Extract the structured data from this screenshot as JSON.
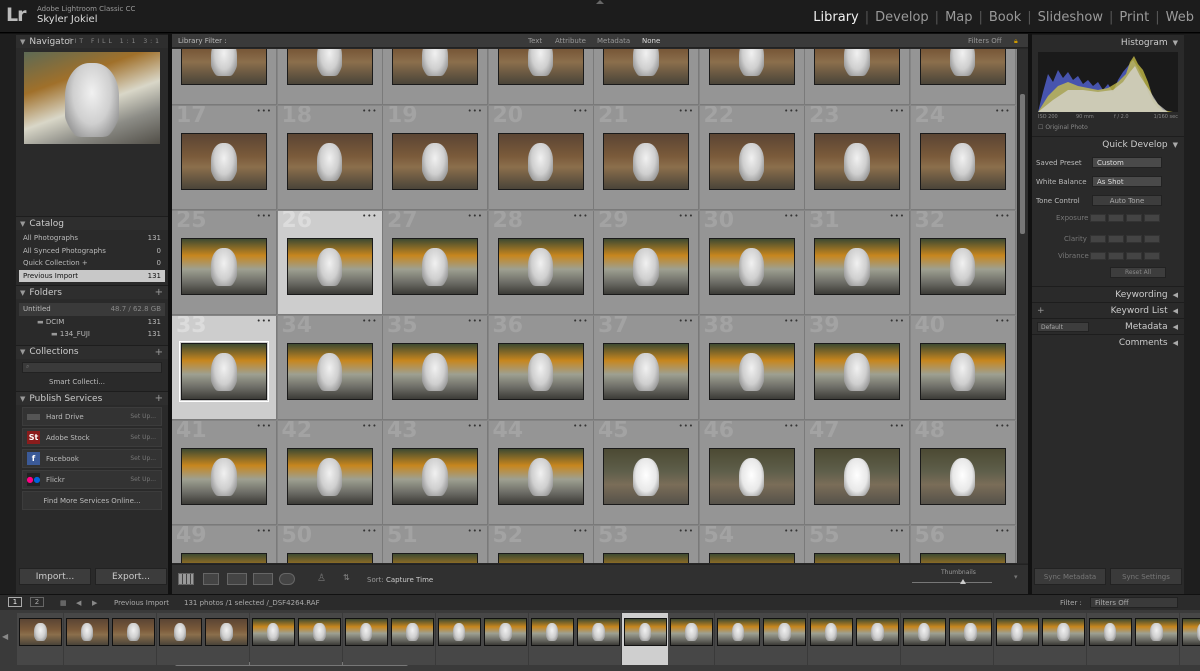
{
  "app": {
    "logo": "Lr",
    "name": "Adobe Lightroom Classic CC",
    "user": "Skyler Jokiel"
  },
  "modules": [
    "Library",
    "Develop",
    "Map",
    "Book",
    "Slideshow",
    "Print",
    "Web"
  ],
  "active_module": "Library",
  "navigator": {
    "title": "Navigator",
    "options": "FIT  FILL  1:1  3:1"
  },
  "catalog": {
    "title": "Catalog",
    "items": [
      {
        "label": "All Photographs",
        "count": "131"
      },
      {
        "label": "All Synced Photographs",
        "count": "0"
      },
      {
        "label": "Quick Collection +",
        "count": "0"
      },
      {
        "label": "Previous Import",
        "count": "131"
      }
    ]
  },
  "folders": {
    "title": "Folders",
    "volume": "Untitled",
    "volume_info": "48.7 / 62.8 GB",
    "items": [
      {
        "label": "DCIM",
        "count": "131"
      },
      {
        "label": "134_FUJI",
        "count": "131"
      }
    ]
  },
  "collections": {
    "title": "Collections",
    "search_placeholder": "",
    "items": [
      {
        "label": "Smart Collecti..."
      }
    ]
  },
  "publish": {
    "title": "Publish Services",
    "items": [
      {
        "label": "Hard Drive",
        "action": "Set Up..."
      },
      {
        "label": "Adobe Stock",
        "action": "Set Up..."
      },
      {
        "label": "Facebook",
        "action": "Set Up..."
      },
      {
        "label": "Flickr",
        "action": "Set Up..."
      }
    ],
    "find_more": "Find More Services Online..."
  },
  "left_buttons": {
    "import": "Import...",
    "export": "Export..."
  },
  "filter_bar": {
    "title": "Library Filter :",
    "text": "Text",
    "attribute": "Attribute",
    "metadata": "Metadata",
    "none": "None",
    "filters_off": "Filters Off"
  },
  "grid": {
    "row_numbers": [
      17,
      25,
      33,
      41,
      49
    ],
    "columns": 8,
    "selected_index": 33,
    "hover_index": 26
  },
  "toolbar": {
    "sort_label": "Sort:",
    "sort_value": "Capture Time",
    "thumbnails_label": "Thumbnails"
  },
  "right_panel": {
    "histogram": {
      "title": "Histogram",
      "iso": "ISO 200",
      "focal": "90 mm",
      "aperture": "f / 2.0",
      "shutter": "1/160 sec",
      "original": "Original Photo"
    },
    "quick_develop": {
      "title": "Quick Develop",
      "saved_preset_label": "Saved Preset",
      "saved_preset_value": "Custom",
      "white_balance_label": "White Balance",
      "white_balance_value": "As Shot",
      "tone_control_label": "Tone Control",
      "auto_tone": "Auto Tone",
      "exposure": "Exposure",
      "clarity": "Clarity",
      "vibrance": "Vibrance",
      "reset": "Reset All"
    },
    "keywording": "Keywording",
    "keyword_list": "Keyword List",
    "metadata": {
      "title": "Metadata",
      "preset": "Default"
    },
    "comments": "Comments",
    "sync_metadata": "Sync Metadata",
    "sync_settings": "Sync Settings"
  },
  "filmstrip": {
    "page1": "1",
    "page2": "2",
    "source": "Previous Import",
    "info": "131 photos /1 selected /_DSF4264.RAF",
    "filter_label": "Filter :",
    "filter_value": "Filters Off",
    "count": 26,
    "selected": 13
  }
}
